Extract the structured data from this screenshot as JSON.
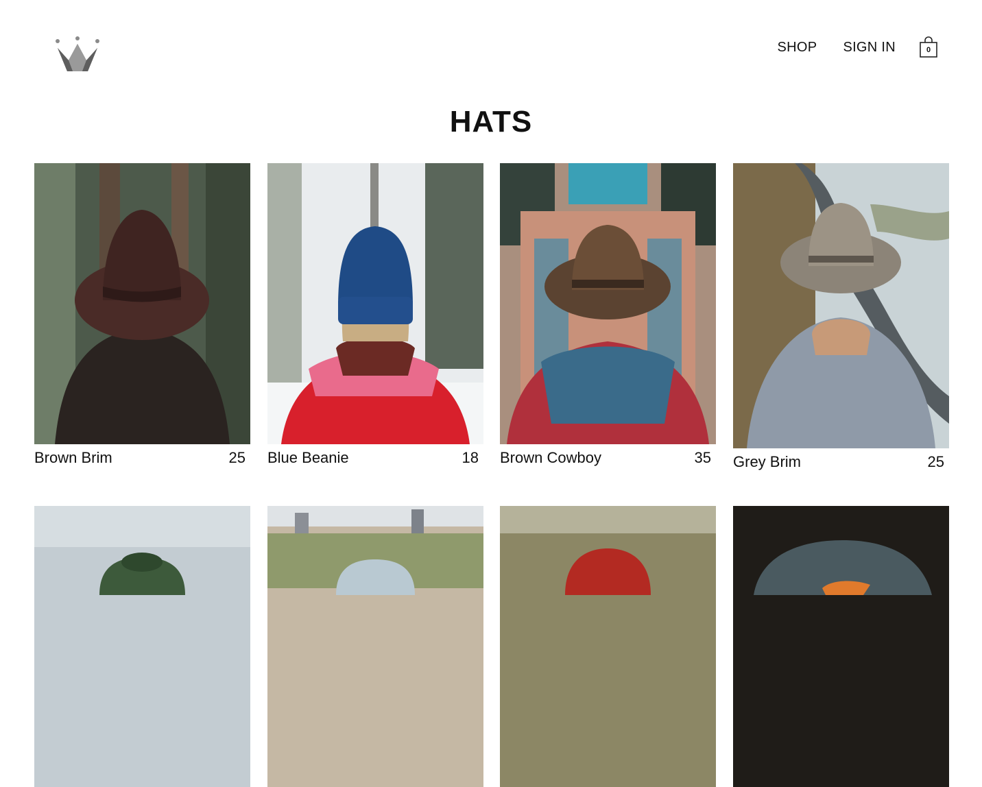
{
  "header": {
    "logo_icon": "crown-logo-icon",
    "nav": {
      "shop_label": "SHOP",
      "signin_label": "SIGN IN",
      "cart_icon": "shopping-bag-icon",
      "cart_count": "0"
    }
  },
  "page": {
    "title": "HATS"
  },
  "products": [
    {
      "name": "Brown Brim",
      "price": "25"
    },
    {
      "name": "Blue Beanie",
      "price": "18"
    },
    {
      "name": "Brown Cowboy",
      "price": "35"
    },
    {
      "name": "Grey Brim",
      "price": "25"
    },
    {
      "name": "",
      "price": ""
    },
    {
      "name": "",
      "price": ""
    },
    {
      "name": "",
      "price": ""
    },
    {
      "name": "",
      "price": ""
    }
  ]
}
